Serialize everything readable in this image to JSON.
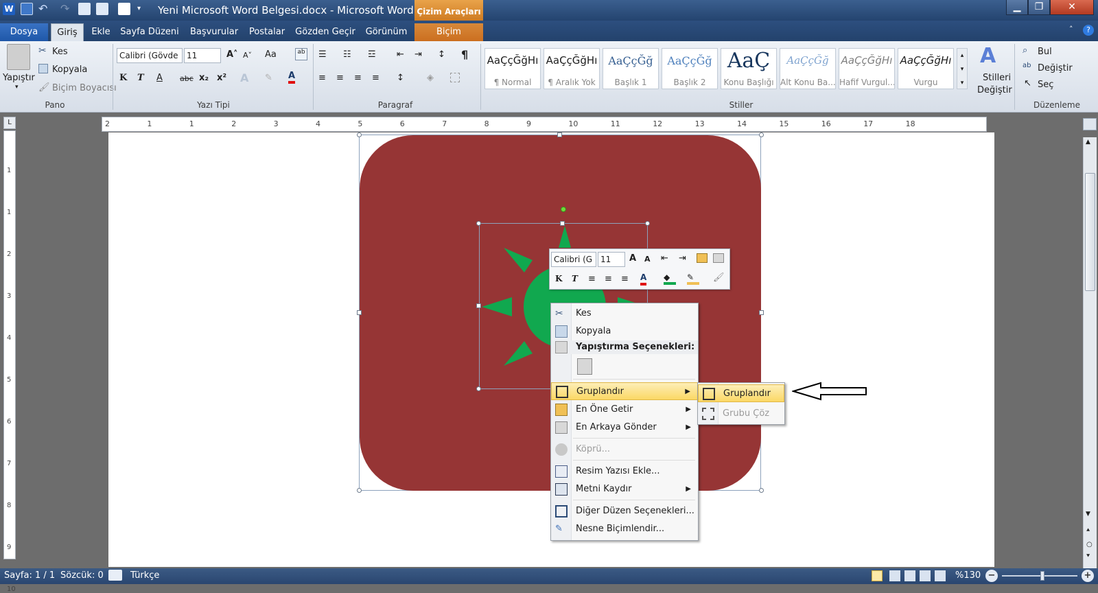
{
  "titlebar": {
    "title": "Yeni Microsoft Word Belgesi.docx - Microsoft Word",
    "context_group": "Çizim Araçları"
  },
  "tabs": [
    {
      "label": "Dosya"
    },
    {
      "label": "Giriş"
    },
    {
      "label": "Ekle"
    },
    {
      "label": "Sayfa Düzeni"
    },
    {
      "label": "Başvurular"
    },
    {
      "label": "Postalar"
    },
    {
      "label": "Gözden Geçir"
    },
    {
      "label": "Görünüm"
    },
    {
      "label": "Biçim"
    }
  ],
  "ribbon": {
    "clipboard": {
      "paste": "Yapıştır",
      "cut": "Kes",
      "copy": "Kopyala",
      "format_painter": "Biçim Boyacısı",
      "label": "Pano"
    },
    "font": {
      "name": "Calibri (Gövde",
      "size": "11",
      "label": "Yazı Tipi",
      "bold": "K",
      "italic": "T",
      "underline": "A",
      "strike": "abc",
      "sub": "x₂",
      "sup": "x²",
      "font_color": "A",
      "grow": "A˄",
      "shrink": "A˅",
      "case": "Aa"
    },
    "paragraph": {
      "label": "Paragraf",
      "pilcrow": "¶"
    },
    "styles": {
      "label": "Stiller",
      "items": [
        {
          "sample": "AaÇçĞğHı",
          "name": "¶ Normal"
        },
        {
          "sample": "AaÇçĞğHı",
          "name": "¶ Aralık Yok"
        },
        {
          "sample": "AaÇçĞğ",
          "name": "Başlık 1"
        },
        {
          "sample": "AaÇçĞğ",
          "name": "Başlık 2"
        },
        {
          "sample": "AaÇ",
          "name": "Konu Başlığı"
        },
        {
          "sample": "AaÇçĞğ",
          "name": "Alt Konu Ba..."
        },
        {
          "sample": "AaÇçĞğHı",
          "name": "Hafif Vurgul..."
        },
        {
          "sample": "AaÇçĞğHı",
          "name": "Vurgu"
        }
      ],
      "change_styles_1": "Stilleri",
      "change_styles_2": "Değiştir"
    },
    "editing": {
      "label": "Düzenleme",
      "find": "Bul",
      "replace": "Değiştir",
      "select": "Seç"
    }
  },
  "ruler": {
    "h_ticks": [
      "2",
      "1",
      "1",
      "2",
      "3",
      "4",
      "5",
      "6",
      "7",
      "8",
      "9",
      "10",
      "11",
      "12",
      "13",
      "14",
      "15",
      "16",
      "17",
      "18"
    ],
    "v_ticks": [
      "1",
      "1",
      "2",
      "3",
      "4",
      "5",
      "6",
      "7",
      "8",
      "9",
      "10"
    ],
    "corner": "L"
  },
  "mini_toolbar": {
    "font": "Calibri (G",
    "size": "11",
    "bold": "K",
    "italic": "T",
    "font_color": "A"
  },
  "context_menu": {
    "items": [
      {
        "label": "Kes",
        "icon": "scissors-icon"
      },
      {
        "label": "Kopyala",
        "icon": "copy-icon"
      },
      {
        "label": "Yapıştırma Seçenekleri:",
        "icon": "paste-icon"
      },
      {
        "label": "Gruplandır",
        "icon": "group-icon"
      },
      {
        "label": "En Öne Getir",
        "icon": "bring-front-icon"
      },
      {
        "label": "En Arkaya Gönder",
        "icon": "send-back-icon"
      },
      {
        "label": "Köprü...",
        "icon": "hyperlink-icon"
      },
      {
        "label": "Resim Yazısı Ekle...",
        "icon": "caption-icon"
      },
      {
        "label": "Metni Kaydır",
        "icon": "wrap-text-icon"
      },
      {
        "label": "Diğer Düzen Seçenekleri...",
        "icon": "layout-options-icon"
      },
      {
        "label": "Nesne Biçimlendir...",
        "icon": "format-object-icon"
      }
    ]
  },
  "submenu": {
    "items": [
      {
        "label": "Gruplandır"
      },
      {
        "label": "Grubu Çöz"
      }
    ]
  },
  "statusbar": {
    "page": "Sayfa: 1 / 1",
    "words": "Sözcük: 0",
    "language": "Türkçe",
    "zoom": "%130"
  },
  "colors": {
    "shape_fill": "#963535",
    "sun_green": "#11a84f",
    "ribbon_blue": "#2b4a76",
    "context_orange": "#d6832f",
    "highlight": "#fbd865"
  }
}
